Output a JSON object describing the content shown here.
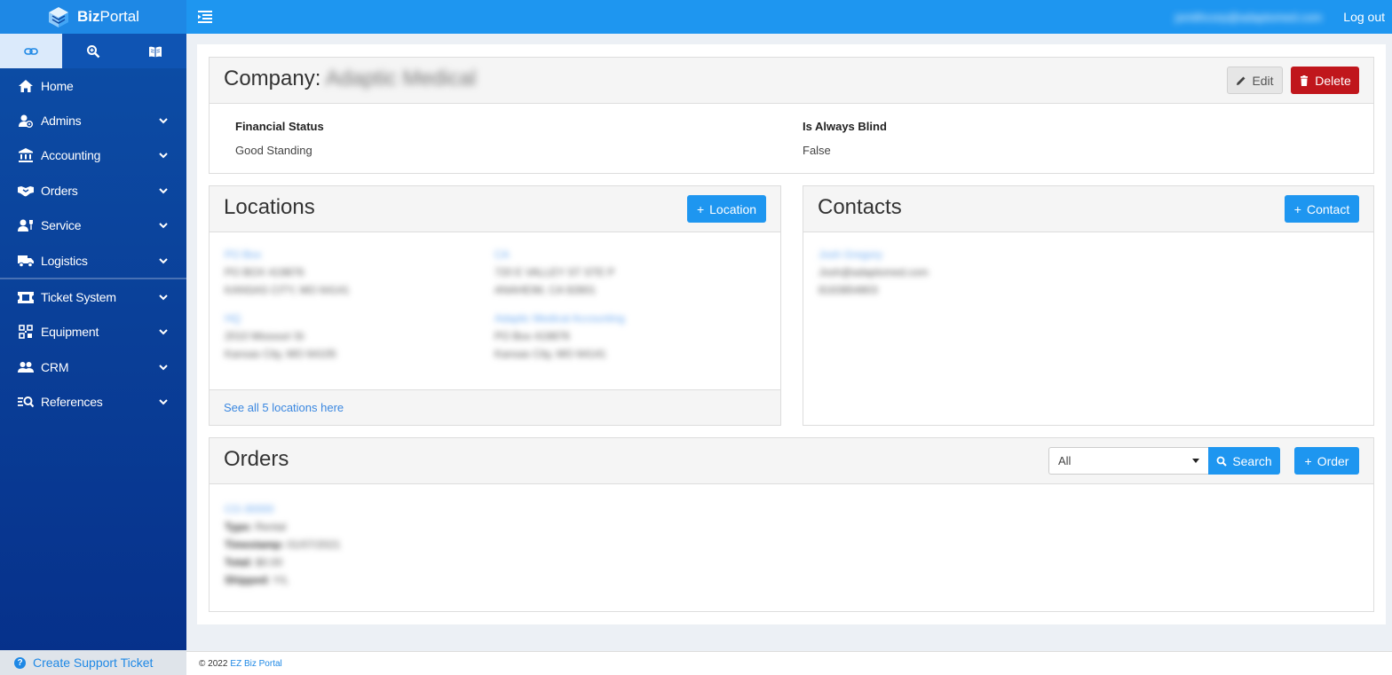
{
  "app": {
    "brand_bold": "Biz",
    "brand_rest": "Portal"
  },
  "sidebar": {
    "tabs": [
      {
        "icon": "link-icon",
        "active": true
      },
      {
        "icon": "zoom-in-icon",
        "active": false
      },
      {
        "icon": "book-icon",
        "active": false
      }
    ],
    "items": [
      {
        "label": "Home",
        "icon": "home-icon",
        "expandable": false
      },
      {
        "label": "Admins",
        "icon": "admins-icon",
        "expandable": true
      },
      {
        "label": "Accounting",
        "icon": "bank-icon",
        "expandable": true
      },
      {
        "label": "Orders",
        "icon": "handshake-icon",
        "expandable": true
      },
      {
        "label": "Service",
        "icon": "service-icon",
        "expandable": true
      },
      {
        "label": "Logistics",
        "icon": "truck-icon",
        "expandable": true
      },
      {
        "label": "Ticket System",
        "icon": "ticket-icon",
        "expandable": true
      },
      {
        "label": "Equipment",
        "icon": "equipment-icon",
        "expandable": true
      },
      {
        "label": "CRM",
        "icon": "people-icon",
        "expandable": true
      },
      {
        "label": "References",
        "icon": "list-search-icon",
        "expandable": true
      }
    ],
    "support_label": "Create Support Ticket"
  },
  "topbar": {
    "user_email": "jsmithcorp@adaptomed.com",
    "logout_label": "Log out"
  },
  "company": {
    "title_prefix": "Company:",
    "name": "Adaptic Medical",
    "edit_label": "Edit",
    "delete_label": "Delete",
    "financial_status_label": "Financial Status",
    "financial_status_value": "Good Standing",
    "always_blind_label": "Is Always Blind",
    "always_blind_value": "False"
  },
  "locations": {
    "title": "Locations",
    "add_label": "Location",
    "items": [
      {
        "name": "PO Box",
        "line1": "PO BOX 419876",
        "line2": "KANSAS CITY, MO 64141"
      },
      {
        "name": "CA",
        "line1": "720 E VALLEY ST STE P",
        "line2": "ANAHEIM, CA 92801"
      },
      {
        "name": "HQ",
        "line1": "2010 Missouri St",
        "line2": "Kansas City, MO 64105"
      },
      {
        "name": "Adaptic Medical Accounting",
        "line1": "PO Box 419876",
        "line2": "Kansas City, MO 64141"
      }
    ],
    "see_all_label": "See all 5 locations here"
  },
  "contacts": {
    "title": "Contacts",
    "add_label": "Contact",
    "items": [
      {
        "name": "Josh Gregory",
        "email": "Josh@adaptomed.com",
        "phone": "8163854803"
      }
    ]
  },
  "orders": {
    "title": "Orders",
    "filter_value": "All",
    "search_label": "Search",
    "add_label": "Order",
    "items": [
      {
        "id": "CO-30000",
        "type_label": "Type:",
        "type": "Rental",
        "timestamp_label": "Timestamp:",
        "timestamp": "01/07/2021",
        "total_label": "Total:",
        "total": "$0.00",
        "shipped_label": "Shipped:",
        "shipped": "Y/L"
      }
    ]
  },
  "footer": {
    "copyright": "© 2022",
    "link_label": "EZ Biz Portal"
  },
  "colors": {
    "primary": "#1e96f0",
    "danger": "#c0161c",
    "sidebar": "#0a3f98"
  }
}
